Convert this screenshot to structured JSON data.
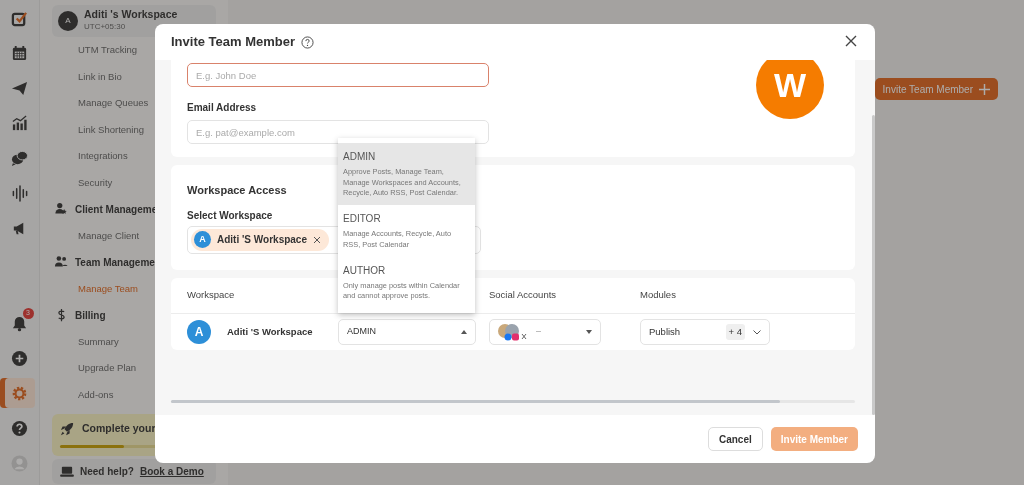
{
  "rail": {
    "items": [
      {
        "kind": "logo",
        "selected": false
      },
      {
        "kind": "calendar",
        "selected": false
      },
      {
        "kind": "send",
        "selected": false
      },
      {
        "kind": "analytics",
        "selected": false
      },
      {
        "kind": "chat",
        "selected": false
      },
      {
        "kind": "waveform",
        "selected": false
      },
      {
        "kind": "megaphone",
        "selected": false
      },
      {
        "kind": "bell",
        "badge": "3",
        "selected": false
      },
      {
        "kind": "plus",
        "selected": false
      },
      {
        "kind": "gear",
        "selected": true
      },
      {
        "kind": "help",
        "selected": false
      },
      {
        "kind": "avatar",
        "selected": false
      }
    ]
  },
  "sidebar": {
    "workspace": {
      "initial": "A",
      "name": "Aditi 's Workspace",
      "timezone": "UTC+05:30"
    },
    "items": [
      {
        "kind": "link",
        "label": "UTM Tracking",
        "selected": false
      },
      {
        "kind": "link",
        "label": "Link in Bio",
        "selected": false
      },
      {
        "kind": "link",
        "label": "Manage Queues",
        "selected": false
      },
      {
        "kind": "link",
        "label": "Link Shortening",
        "selected": false
      },
      {
        "kind": "link",
        "label": "Integrations",
        "selected": false
      },
      {
        "kind": "link",
        "label": "Security",
        "selected": false
      },
      {
        "kind": "clients",
        "label": "Client Manageme"
      },
      {
        "kind": "link",
        "label": "Manage Client",
        "selected": false
      },
      {
        "kind": "team",
        "label": "Team Manageme"
      },
      {
        "kind": "link",
        "label": "Manage Team",
        "selected": true
      },
      {
        "kind": "billing",
        "label": "Billing"
      },
      {
        "kind": "link",
        "label": "Summary",
        "selected": false
      },
      {
        "kind": "link",
        "label": "Upgrade Plan",
        "selected": false
      },
      {
        "kind": "link",
        "label": "Add-ons",
        "selected": false
      }
    ],
    "promo": {
      "text": "Complete your",
      "level": 0.4
    },
    "help": {
      "text": "Need help?",
      "link": "Book a Demo"
    }
  },
  "page": {
    "action_button": "Invite Team Member"
  },
  "modal": {
    "title": "Invite Team Member",
    "name_field": {
      "placeholder": "E.g. John Doe",
      "invalid": true
    },
    "email_label": "Email Address",
    "email_field": {
      "placeholder": "E.g. pat@example.com"
    },
    "avatar_initial": "W",
    "access_title": "Workspace Access",
    "select_label": "Select Workspace",
    "selected_workspaces": [
      {
        "initial": "A",
        "name": "Aditi 'S Workspace"
      }
    ],
    "table": {
      "columns": [
        "Workspace",
        "Social Accounts",
        "Modules"
      ],
      "rows": [
        {
          "initial": "A",
          "workspace": "Aditi 'S Workspace",
          "role": "ADMIN",
          "social": "–",
          "module": "Publish",
          "more": "+ 4"
        }
      ]
    },
    "role_menu": [
      {
        "title": "ADMIN",
        "description": "Approve Posts, Manage Team, Manage Workspaces and Accounts, Recycle, Auto RSS, Post Calendar.",
        "selected": true
      },
      {
        "title": "EDITOR",
        "description": "Manage Accounts, Recycle, Auto RSS, Post Calendar",
        "selected": false
      },
      {
        "title": "AUTHOR",
        "description": "Only manage posts within Calendar and cannot approve posts.",
        "selected": false
      }
    ],
    "buttons": {
      "cancel": "Cancel",
      "submit": "Invite Member",
      "submit_disabled": true
    }
  }
}
